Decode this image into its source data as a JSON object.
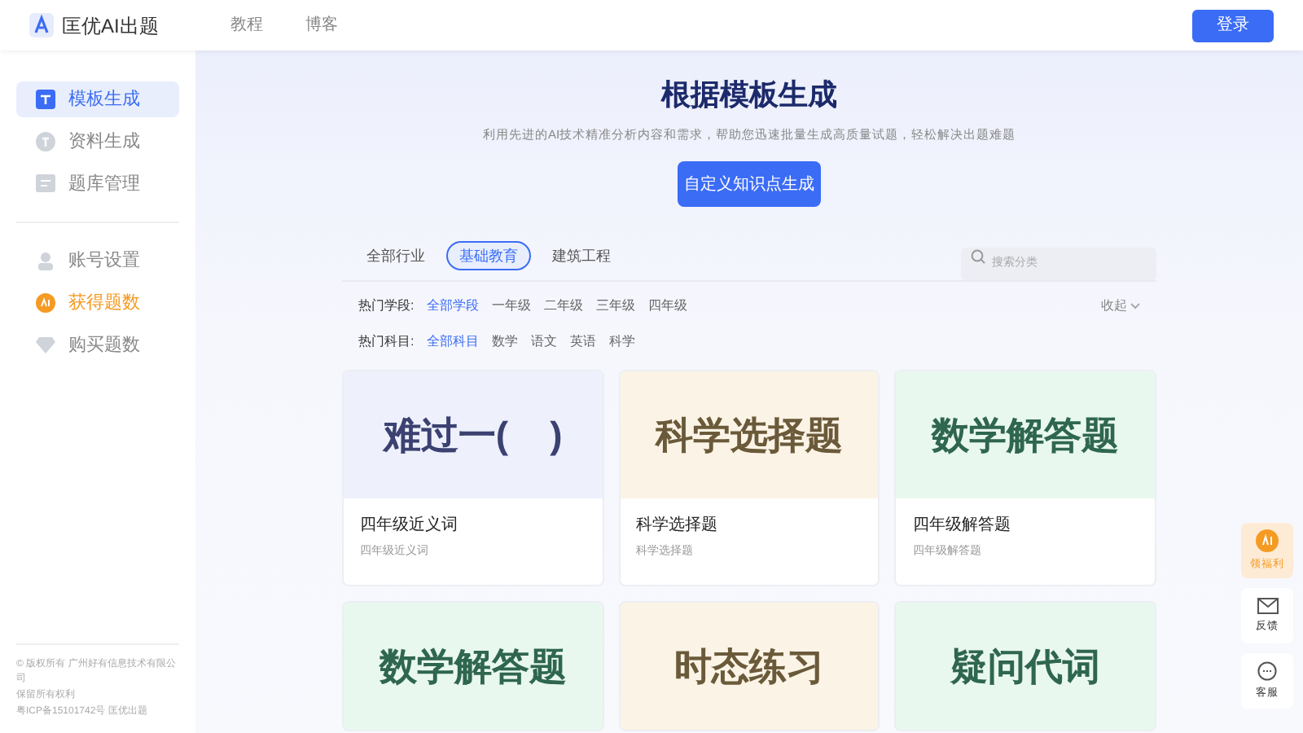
{
  "header": {
    "logo_text": "匡优AI出题",
    "nav": [
      "教程",
      "博客"
    ],
    "login_button": "登录"
  },
  "sidebar": {
    "items": [
      {
        "label": "模板生成",
        "kind": "template",
        "selected": true,
        "accent": false
      },
      {
        "label": "资料生成",
        "kind": "material",
        "selected": false,
        "accent": false
      },
      {
        "label": "题库管理",
        "kind": "bank",
        "selected": false,
        "accent": false
      }
    ],
    "account_items": [
      {
        "label": "账号设置",
        "kind": "user",
        "selected": false,
        "accent": false
      },
      {
        "label": "获得题数",
        "kind": "ai",
        "selected": false,
        "accent": true
      },
      {
        "label": "购买题数",
        "kind": "diamond",
        "selected": false,
        "accent": false
      }
    ],
    "footer": [
      "© 版权所有 广州好有信息技术有限公司",
      "保留所有权利",
      "粤ICP备15101742号 匡优出题"
    ]
  },
  "hero": {
    "title": "根据模板生成",
    "subtitle": "利用先进的AI技术精准分析内容和需求，帮助您迅速批量生成高质量试题，轻松解决出题难题",
    "button": "自定义知识点生成"
  },
  "industry_tabs": [
    {
      "label": "全部行业",
      "selected": false
    },
    {
      "label": "基础教育",
      "selected": true
    },
    {
      "label": "建筑工程",
      "selected": false
    }
  ],
  "search": {
    "placeholder": "搜索分类"
  },
  "filters": [
    {
      "label": "热门学段:",
      "options": [
        {
          "label": "全部学段",
          "selected": true
        },
        {
          "label": "一年级",
          "selected": false
        },
        {
          "label": "二年级",
          "selected": false
        },
        {
          "label": "三年级",
          "selected": false
        },
        {
          "label": "四年级",
          "selected": false
        }
      ]
    },
    {
      "label": "热门科目:",
      "options": [
        {
          "label": "全部科目",
          "selected": true
        },
        {
          "label": "数学",
          "selected": false
        },
        {
          "label": "语文",
          "selected": false
        },
        {
          "label": "英语",
          "selected": false
        },
        {
          "label": "科学",
          "selected": false
        }
      ]
    }
  ],
  "collapse": "收起",
  "cards": [
    {
      "cover": "难过一(    )",
      "color": "#eef0fc",
      "title": "四年级近义词",
      "subtitle": "四年级近义词"
    },
    {
      "cover": "科学选择题",
      "color": "#fbf4e6",
      "title": "科学选择题",
      "subtitle": "科学选择题"
    },
    {
      "cover": "数学解答题",
      "color": "#e9f8ef",
      "title": "四年级解答题",
      "subtitle": "四年级解答题"
    },
    {
      "cover": "数学解答题",
      "color": "#e9f8ef"
    },
    {
      "cover": "时态练习",
      "color": "#fbf4e6"
    },
    {
      "cover": "疑问代词",
      "color": "#e9f8ef"
    }
  ],
  "float_tools": [
    {
      "label": "领福利",
      "kind": "ai"
    },
    {
      "label": "反馈",
      "kind": "mail"
    },
    {
      "label": "客服",
      "kind": "chat"
    }
  ]
}
